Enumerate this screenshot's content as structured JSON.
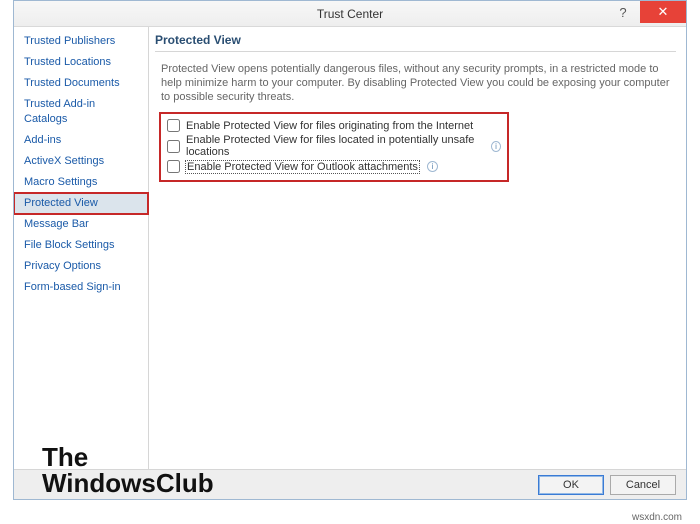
{
  "window": {
    "title": "Trust Center",
    "help": "?",
    "close": "✕"
  },
  "sidebar": {
    "items": [
      {
        "label": "Trusted Publishers"
      },
      {
        "label": "Trusted Locations"
      },
      {
        "label": "Trusted Documents"
      },
      {
        "label": "Trusted Add-in Catalogs"
      },
      {
        "label": "Add-ins"
      },
      {
        "label": "ActiveX Settings"
      },
      {
        "label": "Macro Settings"
      },
      {
        "label": "Protected View",
        "selected": true,
        "highlighted": true
      },
      {
        "label": "Message Bar"
      },
      {
        "label": "File Block Settings"
      },
      {
        "label": "Privacy Options"
      },
      {
        "label": "Form-based Sign-in"
      }
    ]
  },
  "panel": {
    "title": "Protected View",
    "description": "Protected View opens potentially dangerous files, without any security prompts, in a restricted mode to help minimize harm to your computer. By disabling Protected View you could be exposing your computer to possible security threats.",
    "options": [
      {
        "label": "Enable Protected View for files originating from the Internet",
        "checked": false,
        "info": false
      },
      {
        "label": "Enable Protected View for files located in potentially unsafe locations",
        "checked": false,
        "info": true
      },
      {
        "label": "Enable Protected View for Outlook attachments",
        "checked": false,
        "info": true,
        "focused": true
      }
    ]
  },
  "footer": {
    "ok": "OK",
    "cancel": "Cancel"
  },
  "watermark": {
    "line1": "The",
    "line2": "WindowsClub"
  },
  "badge": "wsxdn.com"
}
